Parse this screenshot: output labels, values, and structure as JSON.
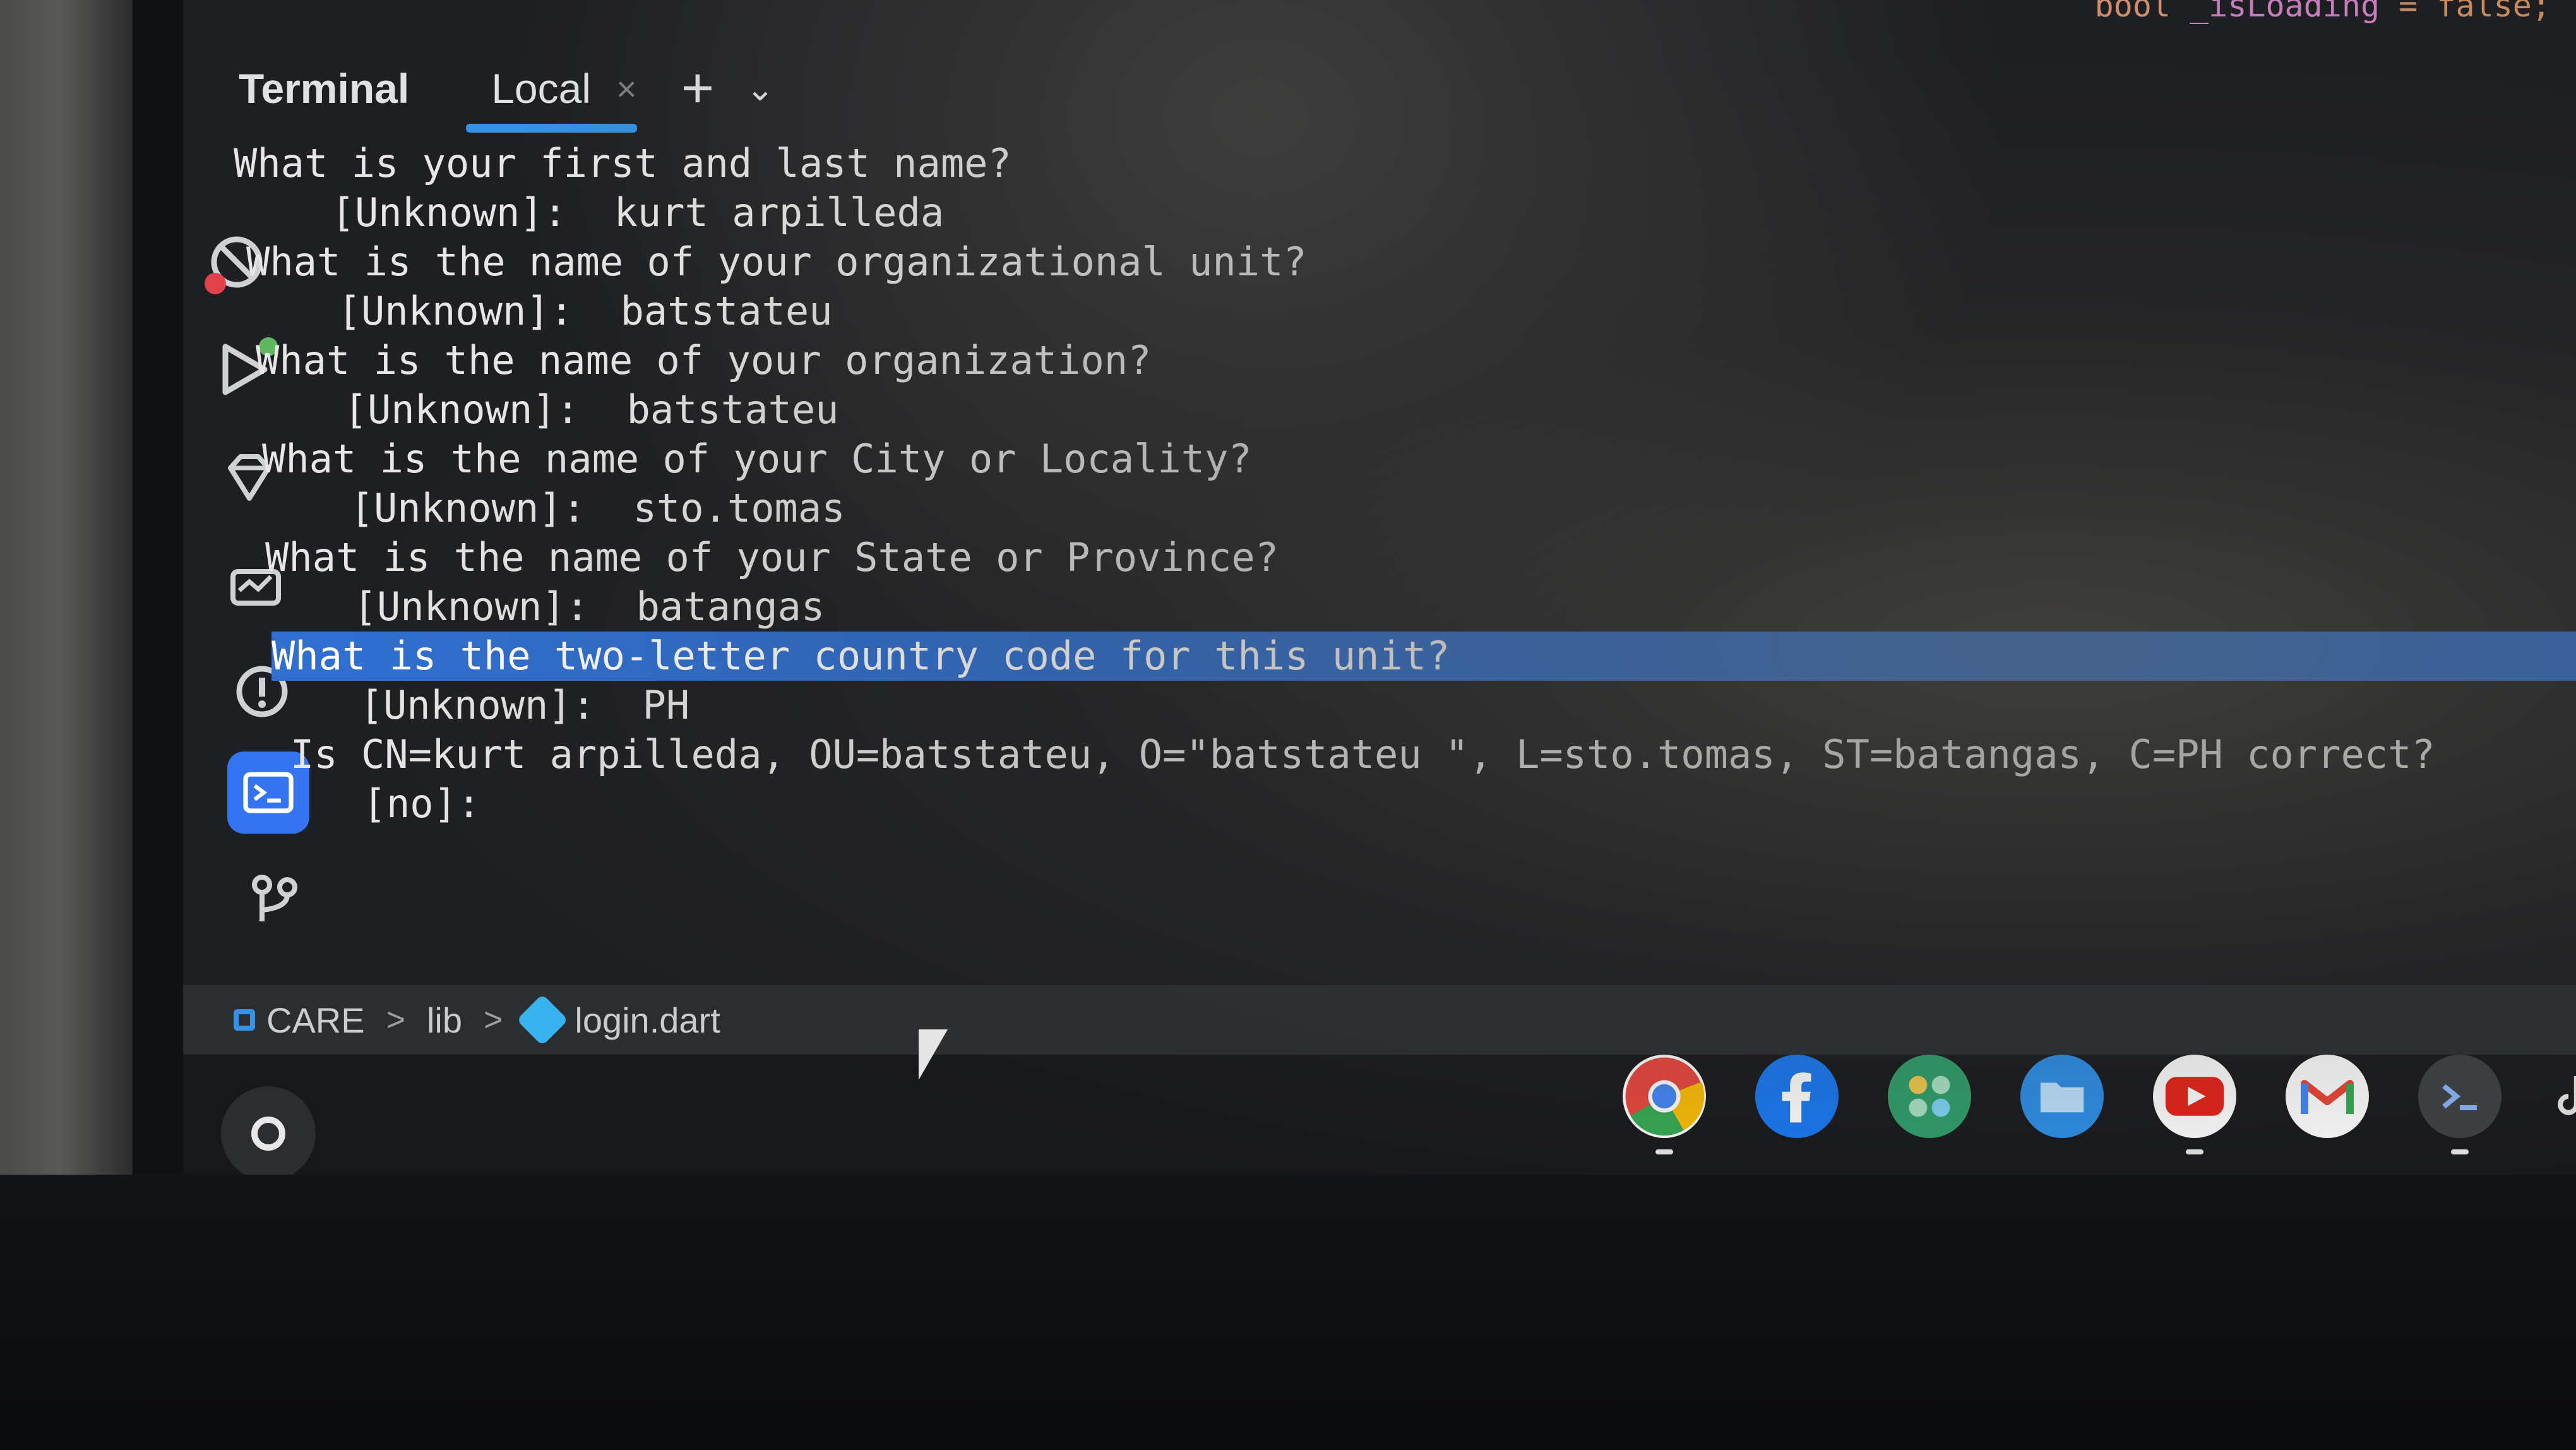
{
  "editor": {
    "code_peek": {
      "keyword": "bool",
      "variable": "_isLoading",
      "rest": " = false;"
    }
  },
  "toolwindow": {
    "title": "Terminal",
    "tabs": [
      {
        "label": "Local",
        "close": "×"
      }
    ],
    "add_label": "+",
    "menu_label": "⌄"
  },
  "terminal": {
    "lines": [
      "What is your first and last name?",
      "  [Unknown]:  kurt arpilleda",
      "What is the name of your organizational unit?",
      "  [Unknown]:  batstateu",
      "What is the name of your organization?",
      "  [Unknown]:  batstateu",
      "What is the name of your City or Locality?",
      "  [Unknown]:  sto.tomas",
      "What is the name of your State or Province?",
      "  [Unknown]:  batangas",
      "What is the two-letter country code for this unit?",
      "  [Unknown]:  PH",
      "Is CN=kurt arpilleda, OU=batstateu, O=\"batstateu \", L=sto.tomas, ST=batangas, C=PH correct?",
      "  [no]:"
    ],
    "highlighted_index": 10
  },
  "breadcrumb": {
    "project": "CARE",
    "folder": "lib",
    "file": "login.dart",
    "separator": ">"
  },
  "toolstrip": {
    "icons": [
      "flutter-inspector-icon",
      "run-icon",
      "ruby-gem-icon",
      "flutter-performance-icon",
      "problems-icon",
      "terminal-icon",
      "version-control-icon"
    ]
  },
  "shelf": {
    "apps": [
      {
        "name": "Chrome",
        "icon": "chrome-icon",
        "running": true
      },
      {
        "name": "Facebook",
        "icon": "facebook-icon",
        "running": false
      },
      {
        "name": "Play Store apps",
        "icon": "apps-grid-icon",
        "running": false
      },
      {
        "name": "Files",
        "icon": "files-icon",
        "running": false
      },
      {
        "name": "YouTube",
        "icon": "youtube-icon",
        "running": true
      },
      {
        "name": "Gmail",
        "icon": "gmail-icon",
        "running": false
      },
      {
        "name": "Terminal",
        "icon": "terminal-app-icon",
        "running": true
      },
      {
        "name": "TikTok",
        "icon": "tiktok-icon",
        "running": false
      }
    ],
    "colors": {
      "chrome": "#e8453c",
      "facebook": "#1877f2",
      "apps": "#2e9e6a",
      "files": "#2b8ee8",
      "youtube": "#e62117",
      "gmail": "#ffffff",
      "terminal": "#3c4043"
    }
  },
  "theme": {
    "accent": "#3574f0",
    "highlight": "#2f6fd0",
    "terminal_bg": "#1e1f22"
  }
}
